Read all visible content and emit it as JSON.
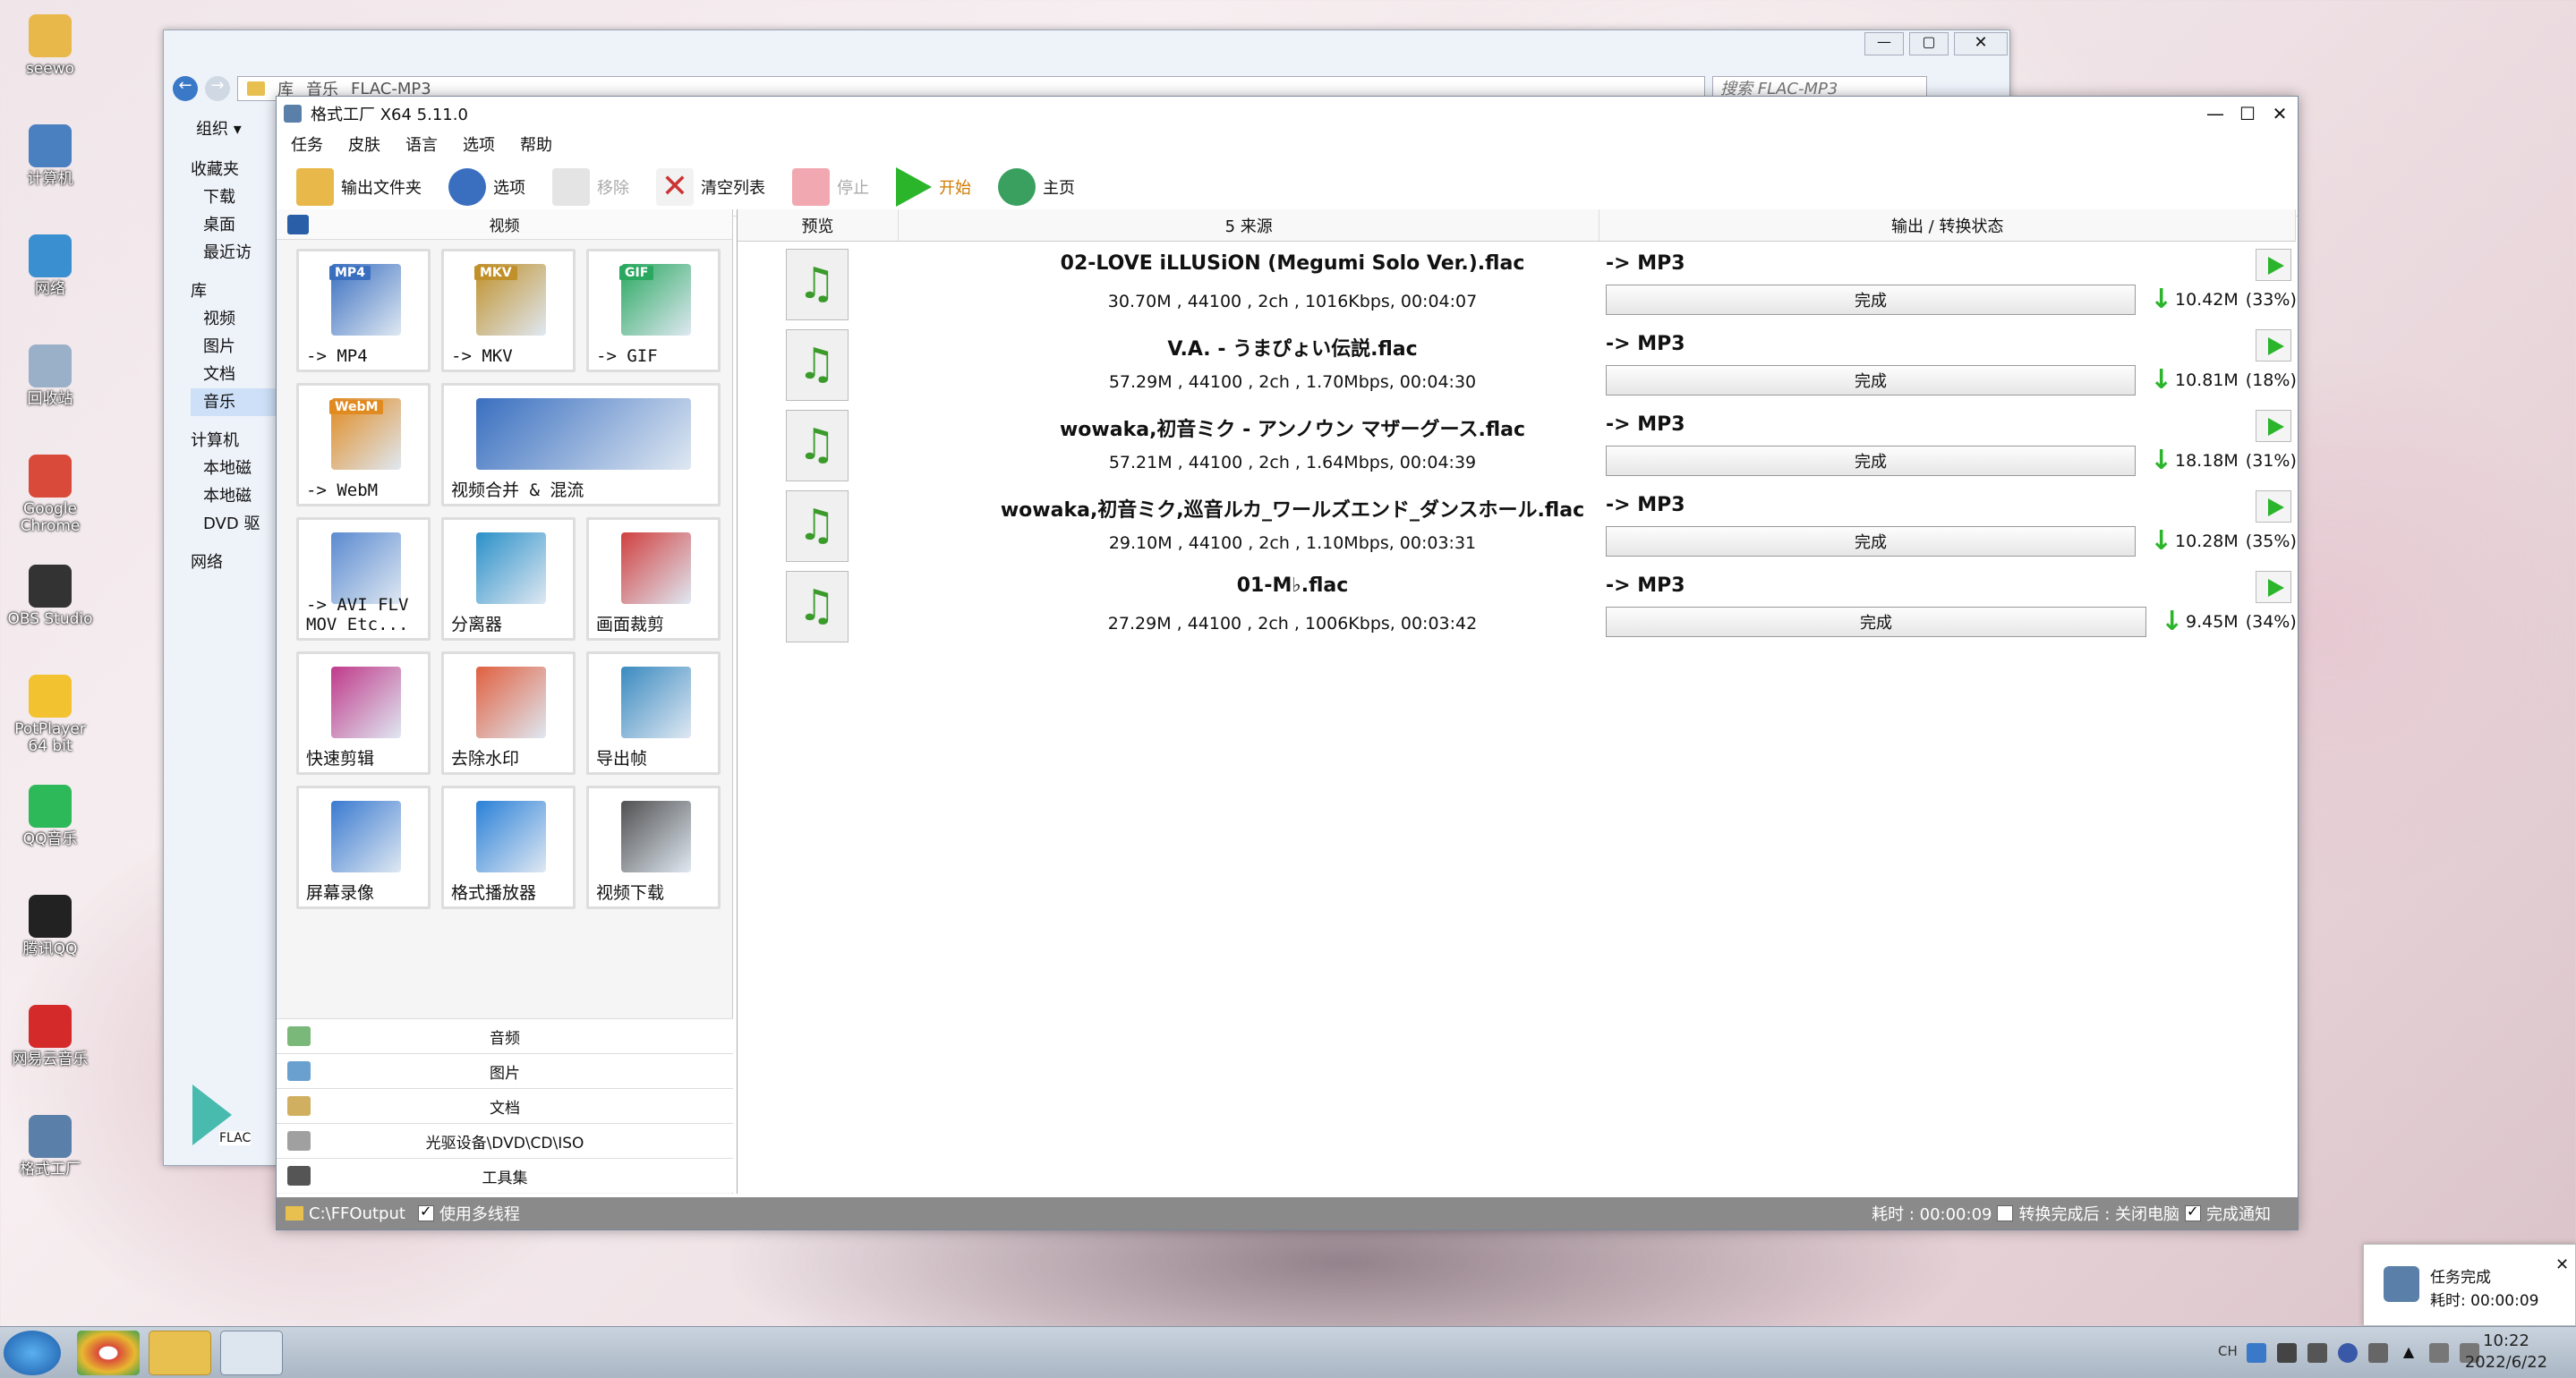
{
  "desktop_icons": [
    {
      "label": "seewo",
      "color": "#e8b84a"
    },
    {
      "label": "计算机",
      "color": "#4a7fc0"
    },
    {
      "label": "网络",
      "color": "#3a8fd0"
    },
    {
      "label": "回收站",
      "color": "#9ab0c8"
    },
    {
      "label": "Google Chrome",
      "color": "#d94a3a"
    },
    {
      "label": "OBS Studio",
      "color": "#333333"
    },
    {
      "label": "PotPlayer 64 bit",
      "color": "#f2c230"
    },
    {
      "label": "QQ音乐",
      "color": "#2db85a"
    },
    {
      "label": "腾讯QQ",
      "color": "#222222"
    },
    {
      "label": "网易云音乐",
      "color": "#d42a2a"
    },
    {
      "label": "格式工厂",
      "color": "#5a7fa8"
    }
  ],
  "explorer": {
    "breadcrumb": [
      "库",
      "音乐",
      "FLAC-MP3"
    ],
    "search_placeholder": "搜索 FLAC-MP3",
    "organize": "组织 ▾",
    "nav": [
      {
        "label": "收藏夹",
        "indent": 0
      },
      {
        "label": "下载",
        "indent": 1
      },
      {
        "label": "桌面",
        "indent": 1
      },
      {
        "label": "最近访",
        "indent": 1
      },
      {
        "label": "库",
        "indent": 0
      },
      {
        "label": "视频",
        "indent": 1
      },
      {
        "label": "图片",
        "indent": 1
      },
      {
        "label": "文档",
        "indent": 1
      },
      {
        "label": "音乐",
        "indent": 1
      },
      {
        "label": "计算机",
        "indent": 0
      },
      {
        "label": "本地磁",
        "indent": 1
      },
      {
        "label": "本地磁",
        "indent": 1
      },
      {
        "label": "DVD 驱",
        "indent": 1
      },
      {
        "label": "网络",
        "indent": 0
      }
    ],
    "flac_label": "FLAC"
  },
  "app": {
    "title": "格式工厂 X64 5.11.0",
    "menu": [
      "任务",
      "皮肤",
      "语言",
      "选项",
      "帮助"
    ],
    "toolbar": {
      "output_folder": "输出文件夹",
      "options": "选项",
      "remove": "移除",
      "clear_list": "清空列表",
      "stop": "停止",
      "start": "开始",
      "home": "主页"
    },
    "video_section": "视频",
    "tiles": [
      {
        "label": "-> MP4",
        "badge": "MP4",
        "badge_color": "#3a6fc0"
      },
      {
        "label": "-> MKV",
        "badge": "MKV",
        "badge_color": "#c0902a"
      },
      {
        "label": "-> GIF",
        "badge": "GIF",
        "badge_color": "#2aa860"
      },
      {
        "label": "-> WebM",
        "badge": "WebM",
        "badge_color": "#e08a20"
      },
      {
        "label": "视频合并 & 混流",
        "badge": "",
        "badge_color": "#3a6fc0"
      },
      {
        "label": "-> AVI FLV MOV Etc...",
        "badge": "",
        "badge_color": "#5a8ad0"
      },
      {
        "label": "分离器",
        "badge": "",
        "badge_color": "#2a90c8"
      },
      {
        "label": "画面裁剪",
        "badge": "",
        "badge_color": "#d04040"
      },
      {
        "label": "快速剪辑",
        "badge": "",
        "badge_color": "#c03a8a"
      },
      {
        "label": "去除水印",
        "badge": "",
        "badge_color": "#e06040"
      },
      {
        "label": "导出帧",
        "badge": "",
        "badge_color": "#3a8ac0"
      },
      {
        "label": "屏幕录像",
        "badge": "",
        "badge_color": "#3a7ad0"
      },
      {
        "label": "格式播放器",
        "badge": "",
        "badge_color": "#2a80d8"
      },
      {
        "label": "视频下载",
        "badge": "",
        "badge_color": "#505050"
      }
    ],
    "categories": [
      "音频",
      "图片",
      "文档",
      "光驱设备\\DVD\\CD\\ISO",
      "工具集"
    ],
    "list_headers": [
      "预览",
      "5 来源",
      "输出 / 转换状态"
    ],
    "tasks": [
      {
        "name": "02-LOVE iLLUSiON (Megumi Solo Ver.).flac",
        "info": "30.70M , 44100 , 2ch , 1016Kbps, 00:04:07",
        "output": "-> MP3",
        "status": "完成",
        "size": "10.42M",
        "pct": "(33%)"
      },
      {
        "name": "V.A. - うまぴょい伝説.flac",
        "info": "57.29M , 44100 , 2ch , 1.70Mbps, 00:04:30",
        "output": "-> MP3",
        "status": "完成",
        "size": "10.81M",
        "pct": "(18%)"
      },
      {
        "name": "wowaka,初音ミク - アンノウン マザーグース.flac",
        "info": "57.21M , 44100 , 2ch , 1.64Mbps, 00:04:39",
        "output": "-> MP3",
        "status": "完成",
        "size": "18.18M",
        "pct": "(31%)"
      },
      {
        "name": "wowaka,初音ミク,巡音ルカ_ワールズエンド_ダンスホール.flac",
        "info": "29.10M , 44100 , 2ch , 1.10Mbps, 00:03:31",
        "output": "-> MP3",
        "status": "完成",
        "size": "10.28M",
        "pct": "(35%)"
      },
      {
        "name": "01-M♭.flac",
        "info": "27.29M , 44100 , 2ch , 1006Kbps, 00:03:42",
        "output": "-> MP3",
        "status": "完成",
        "size": "9.45M",
        "pct": "(34%)"
      }
    ],
    "status": {
      "output_path": "C:\\FFOutput",
      "multithread": "使用多线程",
      "elapsed": "耗时 : 00:00:09",
      "after_done": "转换完成后 : 关闭电脑",
      "notify": "完成通知"
    }
  },
  "toast": {
    "title": "任务完成",
    "elapsed": "耗时: 00:00:09"
  },
  "taskbar": {
    "lang": "CH",
    "time": "10:22",
    "date": "2022/6/22"
  }
}
